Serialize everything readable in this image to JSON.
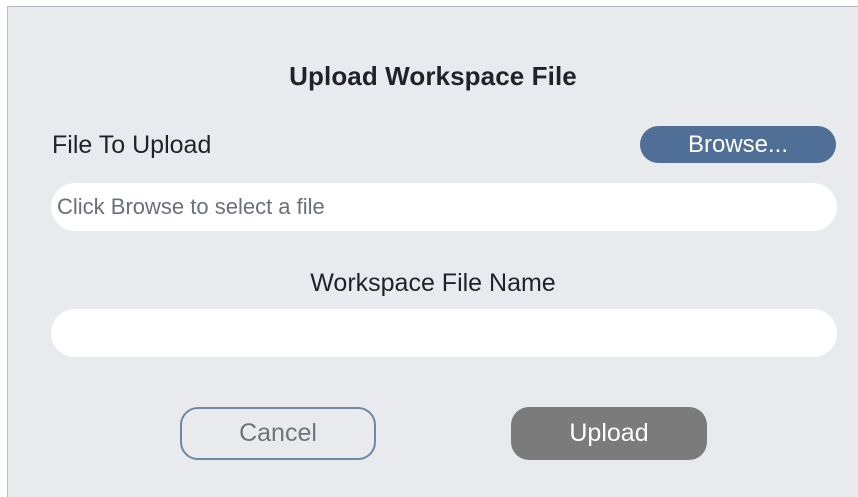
{
  "dialog": {
    "title": "Upload Workspace File",
    "file_label": "File To Upload",
    "browse_label": "Browse...",
    "file_input": {
      "value": "",
      "placeholder": "Click Browse to select a file"
    },
    "name_label": "Workspace File Name",
    "name_input": {
      "value": "",
      "placeholder": ""
    },
    "cancel_label": "Cancel",
    "upload_label": "Upload",
    "upload_enabled": false
  },
  "colors": {
    "background": "#e9eaed",
    "browse_button": "#4f6f96",
    "cancel_border": "#6d88a6",
    "upload_disabled": "#7b7b7b",
    "input_background": "#ffffff"
  }
}
